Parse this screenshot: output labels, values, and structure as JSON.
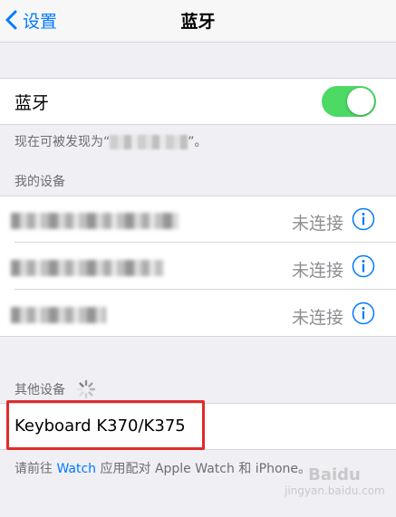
{
  "navbar": {
    "back_label": "设置",
    "title": "蓝牙"
  },
  "bluetooth": {
    "label": "蓝牙",
    "enabled": true,
    "discoverable_prefix": "现在可被发现为“",
    "discoverable_suffix": "”。"
  },
  "my_devices": {
    "header": "我的设备",
    "items": [
      {
        "status": "未连接"
      },
      {
        "status": "未连接"
      },
      {
        "status": "未连接"
      }
    ]
  },
  "other_devices": {
    "header": "其他设备",
    "items": [
      {
        "name": "Keyboard K370/K375"
      }
    ]
  },
  "footer": {
    "prefix": "请前往 ",
    "link": "Watch",
    "suffix": " 应用配对 Apple Watch 和 iPhone。"
  },
  "watermark": {
    "logo": "Baidu",
    "sub": "jingyan.baidu.com"
  },
  "colors": {
    "accent": "#007aff",
    "toggle_on": "#4cd964",
    "highlight": "#e02b2b"
  }
}
